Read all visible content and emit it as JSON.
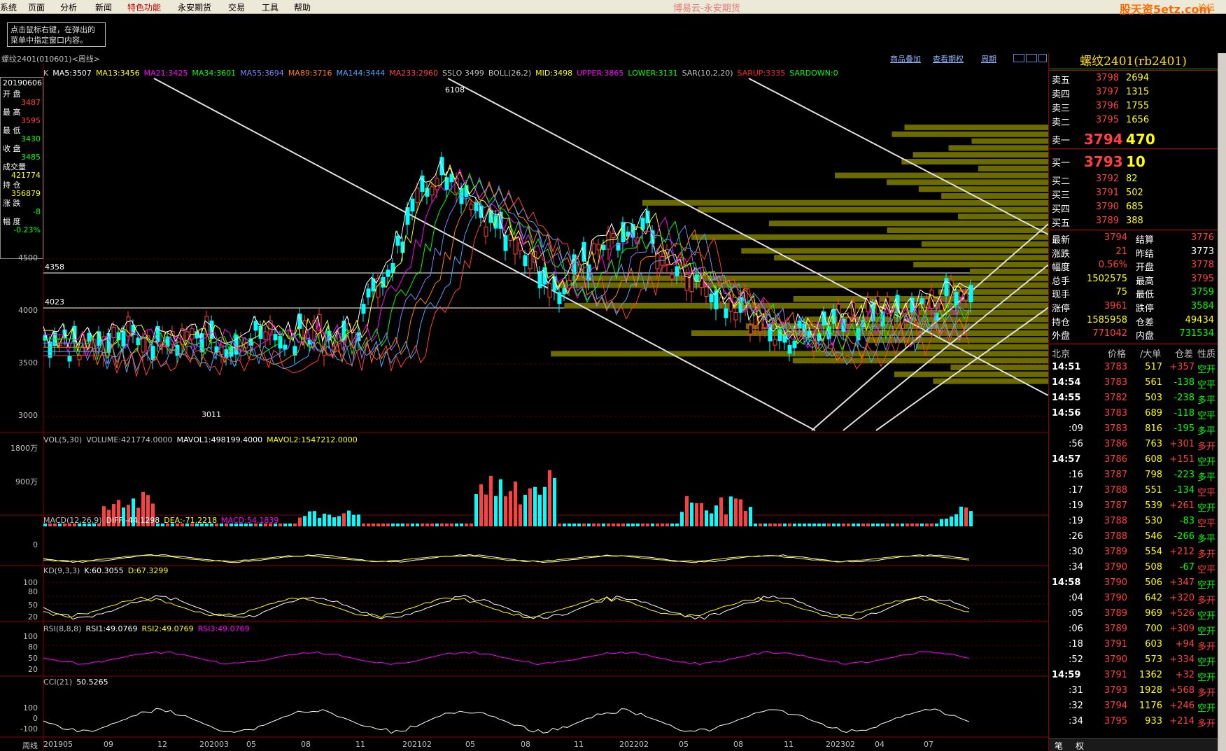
{
  "menu": {
    "items": [
      "系统",
      "页面",
      "分析",
      "新闻",
      "特色功能",
      "永安期货",
      "交易",
      "工具",
      "帮助"
    ],
    "window_title": "博易云-永安期货",
    "watermark": "股天资5etz.com",
    "forum_label": "论坛"
  },
  "tip": {
    "line1": "点击鼠标右键，在弹出的",
    "line2": "菜单中指定窗口内容。"
  },
  "symbol_bar": "螺纹2401(010601)<周线>",
  "toolbar_links": [
    "商品叠加",
    "查看期权",
    "周期"
  ],
  "ma_legend": [
    {
      "text": "K",
      "color": "#c0c0c0"
    },
    {
      "text": "MA5:3507",
      "color": "#ffffff"
    },
    {
      "text": "MA13:3456",
      "color": "#ffff00"
    },
    {
      "text": "MA21:3425",
      "color": "#ff00ff"
    },
    {
      "text": "MA34:3601",
      "color": "#00ff00"
    },
    {
      "text": "MA55:3694",
      "color": "#8080ff"
    },
    {
      "text": "MA89:3716",
      "color": "#ff8000"
    },
    {
      "text": "MA144:3444",
      "color": "#4aa8ff"
    },
    {
      "text": "MA233:2960",
      "color": "#ff4040"
    },
    {
      "text": "SSLO 3499",
      "color": "#c0c0c0"
    },
    {
      "text": "BOLL(26,2)",
      "color": "#c0c0c0"
    },
    {
      "text": "MID:3498",
      "color": "#ffff00"
    },
    {
      "text": "UPPER:3865",
      "color": "#ff00ff"
    },
    {
      "text": "LOWER:3131",
      "color": "#00ff00"
    },
    {
      "text": "SAR(10,2,20)",
      "color": "#c0c0c0"
    },
    {
      "text": "SARUP:3335",
      "color": "#ff2020"
    },
    {
      "text": "SARDOWN:0",
      "color": "#00ff00"
    }
  ],
  "info_box": {
    "date": "20190606",
    "rows": [
      {
        "label": "开  盘",
        "value": "3487",
        "color": "#ff4040"
      },
      {
        "label": "最  高",
        "value": "3595",
        "color": "#ff4040"
      },
      {
        "label": "最  低",
        "value": "3430",
        "color": "#00ff00"
      },
      {
        "label": "收  盘",
        "value": "3485",
        "color": "#00ff00"
      },
      {
        "label": "成交量",
        "value": "421774",
        "color": "#ffff00"
      },
      {
        "label": "持  仓",
        "value": "356879",
        "color": "#ffff00"
      },
      {
        "label": "涨  跌",
        "value": "-8",
        "color": "#00ff00"
      },
      {
        "label": "幅  度",
        "value": "-0.23%",
        "color": "#00ff00"
      }
    ]
  },
  "price_axis": [
    "4500",
    "4000",
    "3500",
    "3000"
  ],
  "price_marks": {
    "line_a": "4358",
    "line_b": "4023",
    "peak": "6108",
    "trough": "3011"
  },
  "vol_legend": [
    {
      "text": "VOL(5,30)",
      "color": "#c0c0c0"
    },
    {
      "text": "VOLUME:421774.0000",
      "color": "#c0c0c0"
    },
    {
      "text": "MAVOL1:498199.4000",
      "color": "#ffffff"
    },
    {
      "text": "MAVOL2:1547212.0000",
      "color": "#ffff00"
    }
  ],
  "vol_axis": [
    "1800万",
    "900万"
  ],
  "macd_legend": [
    {
      "text": "MACD(12,26,9)",
      "color": "#c0c0c0"
    },
    {
      "text": "DIFF:-44.1298",
      "color": "#ffffff"
    },
    {
      "text": "DEA:-71.2218",
      "color": "#ffff00"
    },
    {
      "text": "MACD:54.1839",
      "color": "#ff00ff"
    }
  ],
  "macd_axis": [
    "0"
  ],
  "kd_legend": [
    {
      "text": "KD(9,3,3)",
      "color": "#c0c0c0"
    },
    {
      "text": "K:60.3055",
      "color": "#ffffff"
    },
    {
      "text": "D:67.3299",
      "color": "#ffff00"
    }
  ],
  "kd_axis": [
    "100",
    "80",
    "50",
    "20"
  ],
  "rsi_legend": [
    {
      "text": "RSI(8,8,8)",
      "color": "#c0c0c0"
    },
    {
      "text": "RSI1:49.0769",
      "color": "#ffffff"
    },
    {
      "text": "RSI2:49.0769",
      "color": "#ffff00"
    },
    {
      "text": "RSI3:49.0769",
      "color": "#ff00ff"
    }
  ],
  "rsi_axis": [
    "100",
    "80",
    "50",
    "20"
  ],
  "cci_legend": [
    {
      "text": "CCI(21)",
      "color": "#c0c0c0"
    },
    {
      "text": "50.5265",
      "color": "#ffffff"
    }
  ],
  "cci_axis": [
    "100",
    "0",
    "-100"
  ],
  "x_axis": {
    "period_label": "周线",
    "labels": [
      "201905",
      "09",
      "12",
      "202003",
      "05",
      "08",
      "11",
      "202102",
      "05",
      "08",
      "11",
      "202202",
      "05",
      "08",
      "11",
      "202302",
      "04",
      "07"
    ]
  },
  "quote": {
    "title": "螺纹2401(rb2401)",
    "asks": [
      {
        "label": "卖五",
        "price": "3798",
        "vol": "2694"
      },
      {
        "label": "卖四",
        "price": "3797",
        "vol": "1315"
      },
      {
        "label": "卖三",
        "price": "3796",
        "vol": "1755"
      },
      {
        "label": "卖二",
        "price": "3795",
        "vol": "1656"
      },
      {
        "label": "卖一",
        "price": "3794",
        "vol": "470"
      }
    ],
    "bids": [
      {
        "label": "买一",
        "price": "3793",
        "vol": "10"
      },
      {
        "label": "买二",
        "price": "3792",
        "vol": "82"
      },
      {
        "label": "买三",
        "price": "3791",
        "vol": "502"
      },
      {
        "label": "买四",
        "price": "3790",
        "vol": "685"
      },
      {
        "label": "买五",
        "price": "3789",
        "vol": "388"
      }
    ],
    "stats": [
      {
        "l1": "最新",
        "v1": "3794",
        "c1": "#ff4040",
        "l2": "结算",
        "v2": "3776",
        "c2": "#ff4040"
      },
      {
        "l1": "涨跌",
        "v1": "21",
        "c1": "#ff4040",
        "l2": "昨结",
        "v2": "3773",
        "c2": "#ffffff"
      },
      {
        "l1": "幅度",
        "v1": "0.56%",
        "c1": "#ff4040",
        "l2": "开盘",
        "v2": "3778",
        "c2": "#ff4040"
      },
      {
        "l1": "总手",
        "v1": "1502575",
        "c1": "#ffff00",
        "l2": "最高",
        "v2": "3795",
        "c2": "#ff4040"
      },
      {
        "l1": "现手",
        "v1": "75",
        "c1": "#ffff00",
        "l2": "最低",
        "v2": "3759",
        "c2": "#00ff00"
      },
      {
        "l1": "涨停",
        "v1": "3961",
        "c1": "#ff4040",
        "l2": "跌停",
        "v2": "3584",
        "c2": "#00ff00"
      },
      {
        "l1": "持仓",
        "v1": "1585958",
        "c1": "#ffff00",
        "l2": "仓差",
        "v2": "49434",
        "c2": "#ffff00"
      },
      {
        "l1": "外盘",
        "v1": "771042",
        "c1": "#ff4040",
        "l2": "内盘",
        "v2": "731534",
        "c2": "#00ff00"
      }
    ],
    "tick_headers": [
      "北京",
      "价格",
      "/大单",
      "仓差",
      "性质"
    ],
    "ticks": [
      {
        "t": "14:51",
        "p": "3783",
        "v": "517",
        "d": "+357",
        "n": "空开",
        "nc": "#00ff00",
        "big": true
      },
      {
        "t": "14:54",
        "p": "3783",
        "v": "561",
        "d": "-138",
        "n": "空平",
        "nc": "#00ff00",
        "big": true
      },
      {
        "t": "14:55",
        "p": "3782",
        "v": "503",
        "d": "-238",
        "n": "多平",
        "nc": "#00ff00",
        "big": true
      },
      {
        "t": "14:56",
        "p": "3783",
        "v": "689",
        "d": "-118",
        "n": "空平",
        "nc": "#00ff00",
        "big": true
      },
      {
        "t": ":09",
        "p": "3783",
        "v": "816",
        "d": "-195",
        "n": "多平",
        "nc": "#00ff00",
        "big": false
      },
      {
        "t": ":56",
        "p": "3786",
        "v": "763",
        "d": "+301",
        "n": "多开",
        "nc": "#ff4040",
        "big": false
      },
      {
        "t": "14:57",
        "p": "3786",
        "v": "608",
        "d": "+151",
        "n": "空开",
        "nc": "#00ff00",
        "big": true
      },
      {
        "t": ":16",
        "p": "3787",
        "v": "798",
        "d": "-223",
        "n": "多平",
        "nc": "#00ff00",
        "big": false
      },
      {
        "t": ":17",
        "p": "3788",
        "v": "551",
        "d": "-134",
        "n": "空平",
        "nc": "#ff4040",
        "big": false
      },
      {
        "t": ":19",
        "p": "3787",
        "v": "539",
        "d": "+261",
        "n": "空开",
        "nc": "#00ff00",
        "big": false
      },
      {
        "t": ":19",
        "p": "3788",
        "v": "530",
        "d": "-83",
        "n": "空平",
        "nc": "#ff4040",
        "big": false
      },
      {
        "t": ":26",
        "p": "3788",
        "v": "546",
        "d": "-266",
        "n": "多平",
        "nc": "#00ff00",
        "big": false
      },
      {
        "t": ":30",
        "p": "3789",
        "v": "554",
        "d": "+212",
        "n": "多开",
        "nc": "#ff4040",
        "big": false
      },
      {
        "t": ":34",
        "p": "3790",
        "v": "508",
        "d": "-67",
        "n": "空平",
        "nc": "#ff4040",
        "big": false
      },
      {
        "t": "14:58",
        "p": "3790",
        "v": "506",
        "d": "+347",
        "n": "空开",
        "nc": "#00ff00",
        "big": true
      },
      {
        "t": ":04",
        "p": "3790",
        "v": "642",
        "d": "+320",
        "n": "多开",
        "nc": "#ff4040",
        "big": false
      },
      {
        "t": ":05",
        "p": "3789",
        "v": "969",
        "d": "+526",
        "n": "空开",
        "nc": "#00ff00",
        "big": false
      },
      {
        "t": ":06",
        "p": "3789",
        "v": "700",
        "d": "+309",
        "n": "空开",
        "nc": "#00ff00",
        "big": false
      },
      {
        "t": ":18",
        "p": "3791",
        "v": "603",
        "d": "+94",
        "n": "多开",
        "nc": "#ff4040",
        "big": false
      },
      {
        "t": ":52",
        "p": "3790",
        "v": "573",
        "d": "+334",
        "n": "空开",
        "nc": "#00ff00",
        "big": false
      },
      {
        "t": "14:59",
        "p": "3791",
        "v": "1362",
        "d": "+32",
        "n": "空开",
        "nc": "#00ff00",
        "big": true
      },
      {
        "t": ":31",
        "p": "3793",
        "v": "1928",
        "d": "+568",
        "n": "多开",
        "nc": "#ff4040",
        "big": false
      },
      {
        "t": ":32",
        "p": "3794",
        "v": "1176",
        "d": "+246",
        "n": "空开",
        "nc": "#00ff00",
        "big": false
      },
      {
        "t": ":34",
        "p": "3795",
        "v": "933",
        "d": "+214",
        "n": "多开",
        "nc": "#ff4040",
        "big": false
      }
    ],
    "bottom_tabs": [
      "笔",
      "权"
    ]
  }
}
